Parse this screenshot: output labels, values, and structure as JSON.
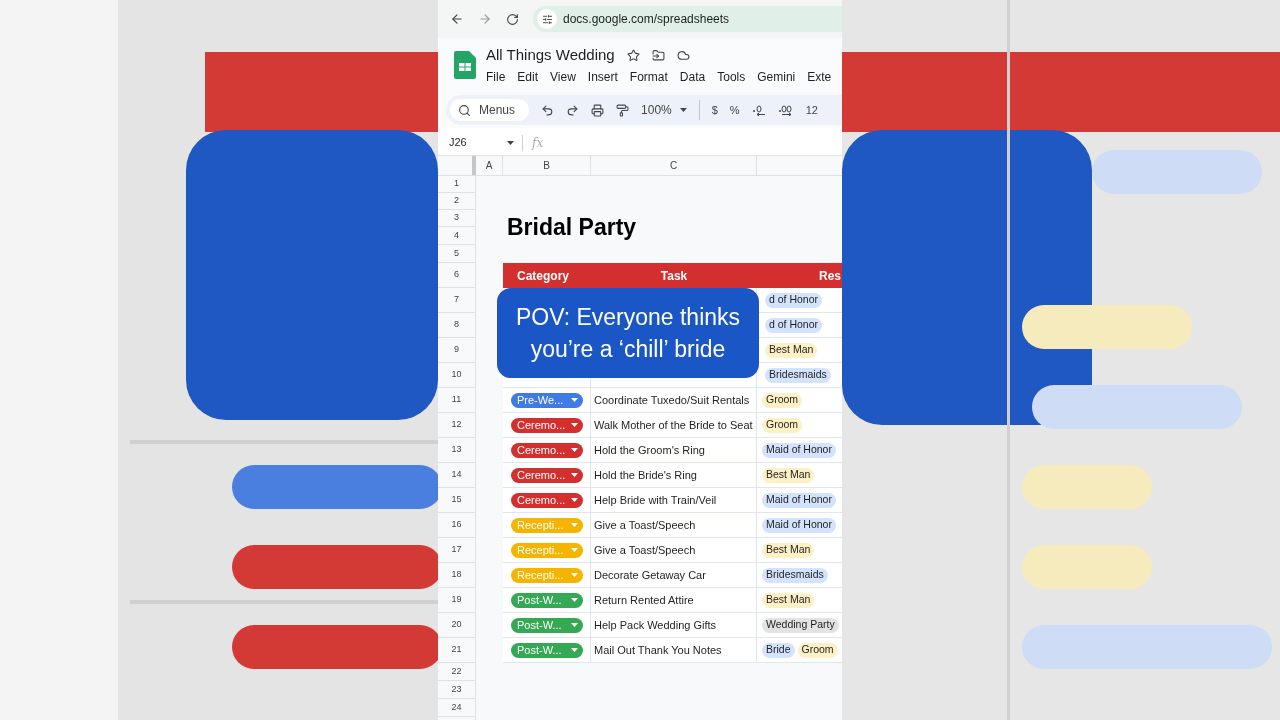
{
  "browser": {
    "url": "docs.google.com/spreadsheets"
  },
  "document": {
    "title": "All Things Wedding",
    "menus": [
      "File",
      "Edit",
      "View",
      "Insert",
      "Format",
      "Data",
      "Tools",
      "Gemini",
      "Exte"
    ]
  },
  "toolbar": {
    "search_placeholder": "Menus",
    "zoom": "100%",
    "buttons": [
      "$",
      "%"
    ],
    "cut_label": "12"
  },
  "formula_bar": {
    "cell": "J26",
    "function_label": "fx"
  },
  "columns": [
    "A",
    "B",
    "C"
  ],
  "row_numbers": [
    "1",
    "2",
    "3",
    "4",
    "5",
    "6",
    "7",
    "8",
    "9",
    "10",
    "11",
    "12",
    "13",
    "14",
    "15",
    "16",
    "17",
    "18",
    "19",
    "20",
    "21",
    "22",
    "23",
    "24"
  ],
  "sheet_title": "Bridal Party",
  "table": {
    "columns": [
      "Category",
      "Task",
      "Res"
    ],
    "rows": [
      {
        "kind": "covered",
        "responsible": [
          {
            "label": "d of Honor",
            "color": "#d3e3fd"
          }
        ]
      },
      {
        "kind": "covered",
        "responsible": [
          {
            "label": "d of Honor",
            "color": "#d3e3fd"
          }
        ]
      },
      {
        "kind": "covered",
        "responsible": [
          {
            "label": "Best Man",
            "color": "#fdf0c4"
          }
        ]
      },
      {
        "kind": "covered",
        "responsible": [
          {
            "label": "Bridesmaids",
            "color": "#d3e3fd"
          }
        ]
      },
      {
        "kind": "full",
        "category": "Pre-We...",
        "color": "#3f7be6",
        "task": "Coordinate Tuxedo/Suit Rentals",
        "responsible": [
          {
            "label": "Groom",
            "color": "#fdf0c4"
          }
        ]
      },
      {
        "kind": "full",
        "category": "Ceremo...",
        "color": "#d32f2f",
        "task": "Walk Mother of the Bride to Seat",
        "responsible": [
          {
            "label": "Groom",
            "color": "#fdf0c4"
          }
        ]
      },
      {
        "kind": "full",
        "category": "Ceremo...",
        "color": "#d32f2f",
        "task": "Hold the Groom's Ring",
        "responsible": [
          {
            "label": "Maid of Honor",
            "color": "#d3e3fd"
          }
        ]
      },
      {
        "kind": "full",
        "category": "Ceremo...",
        "color": "#d32f2f",
        "task": "Hold the Bride's Ring",
        "responsible": [
          {
            "label": "Best Man",
            "color": "#fdf0c4"
          }
        ]
      },
      {
        "kind": "full",
        "category": "Ceremo...",
        "color": "#d32f2f",
        "task": "Help Bride with Train/Veil",
        "responsible": [
          {
            "label": "Maid of Honor",
            "color": "#d3e3fd"
          }
        ]
      },
      {
        "kind": "full",
        "category": "Recepti...",
        "color": "#f4b400",
        "task": "Give a Toast/Speech",
        "responsible": [
          {
            "label": "Maid of Honor",
            "color": "#d3e3fd"
          }
        ]
      },
      {
        "kind": "full",
        "category": "Recepti...",
        "color": "#f4b400",
        "task": "Give a Toast/Speech",
        "responsible": [
          {
            "label": "Best Man",
            "color": "#fdf0c4"
          }
        ]
      },
      {
        "kind": "full",
        "category": "Recepti...",
        "color": "#f4b400",
        "task": "Decorate Getaway Car",
        "responsible": [
          {
            "label": "Bridesmaids",
            "color": "#d3e3fd"
          }
        ]
      },
      {
        "kind": "full",
        "category": "Post-W...",
        "color": "#34a853",
        "task": "Return Rented Attire",
        "responsible": [
          {
            "label": "Best Man",
            "color": "#fdf0c4"
          }
        ]
      },
      {
        "kind": "full",
        "category": "Post-W...",
        "color": "#34a853",
        "task": "Help Pack Wedding Gifts",
        "responsible": [
          {
            "label": "Wedding Party",
            "color": "#e3e3e3"
          }
        ]
      },
      {
        "kind": "full",
        "category": "Post-W...",
        "color": "#34a853",
        "task": "Mail Out Thank You Notes",
        "responsible": [
          {
            "label": "Bride",
            "color": "#d3e3fd"
          },
          {
            "label": "Groom",
            "color": "#fdf0c4"
          }
        ]
      }
    ]
  },
  "caption": "POV: Everyone thinks you’re a ‘chill’ bride"
}
